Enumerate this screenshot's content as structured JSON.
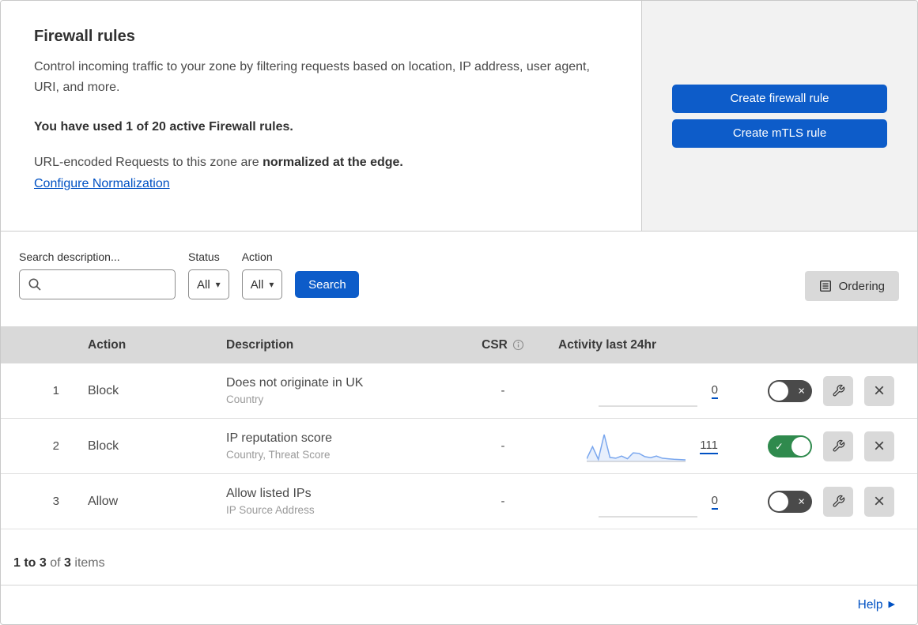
{
  "hero": {
    "title": "Firewall rules",
    "description": "Control incoming traffic to your zone by filtering requests based on location, IP address, user agent, URI, and more.",
    "usage_notice": "You have used 1 of 20 active Firewall rules.",
    "normalization_text": "URL-encoded Requests to this zone are ",
    "normalization_bold": "normalized at the edge.",
    "normalization_link": "Configure Normalization",
    "create_firewall_button": "Create firewall rule",
    "create_mtls_button": "Create mTLS rule"
  },
  "filters": {
    "search_label": "Search description...",
    "status_label": "Status",
    "status_value": "All",
    "action_label": "Action",
    "action_value": "All",
    "search_button": "Search",
    "ordering_button": "Ordering"
  },
  "table": {
    "headers": {
      "action": "Action",
      "description": "Description",
      "csr": "CSR",
      "activity": "Activity last 24hr"
    },
    "rows": [
      {
        "index": "1",
        "action": "Block",
        "description": "Does not originate in UK",
        "expression": "Country",
        "csr": "-",
        "activity_count": "0",
        "enabled": false,
        "sparkline": []
      },
      {
        "index": "2",
        "action": "Block",
        "description": "IP reputation score",
        "expression": "Country, Threat Score",
        "csr": "-",
        "activity_count": "111",
        "enabled": true,
        "sparkline": [
          10,
          55,
          8,
          100,
          15,
          12,
          20,
          10,
          32,
          30,
          18,
          14,
          20,
          12,
          10,
          8,
          7,
          6
        ]
      },
      {
        "index": "3",
        "action": "Allow",
        "description": "Allow listed IPs",
        "expression": "IP Source Address",
        "csr": "-",
        "activity_count": "0",
        "enabled": false,
        "sparkline": []
      }
    ]
  },
  "chart_data": {
    "type": "area",
    "title": "Activity last 24hr sparkline for rule 2 (IP reputation score)",
    "x": [
      1,
      2,
      3,
      4,
      5,
      6,
      7,
      8,
      9,
      10,
      11,
      12,
      13,
      14,
      15,
      16,
      17,
      18
    ],
    "values": [
      10,
      55,
      8,
      100,
      15,
      12,
      20,
      10,
      32,
      30,
      18,
      14,
      20,
      12,
      10,
      8,
      7,
      6
    ],
    "total_events": 111,
    "ylim": [
      0,
      100
    ],
    "grid": false,
    "legend": false
  },
  "footer": {
    "range": "1 to 3",
    "of": "of",
    "total": "3",
    "items": "items",
    "help": "Help"
  },
  "colors": {
    "accent_blue": "#0d5cc9",
    "link_blue": "#0051c3",
    "toggle_on": "#2f8a4d",
    "toggle_off": "#4a4a4a",
    "sparkline": "#7aa7ee",
    "panel_gray": "#f2f2f2",
    "header_gray": "#d9d9d9"
  }
}
